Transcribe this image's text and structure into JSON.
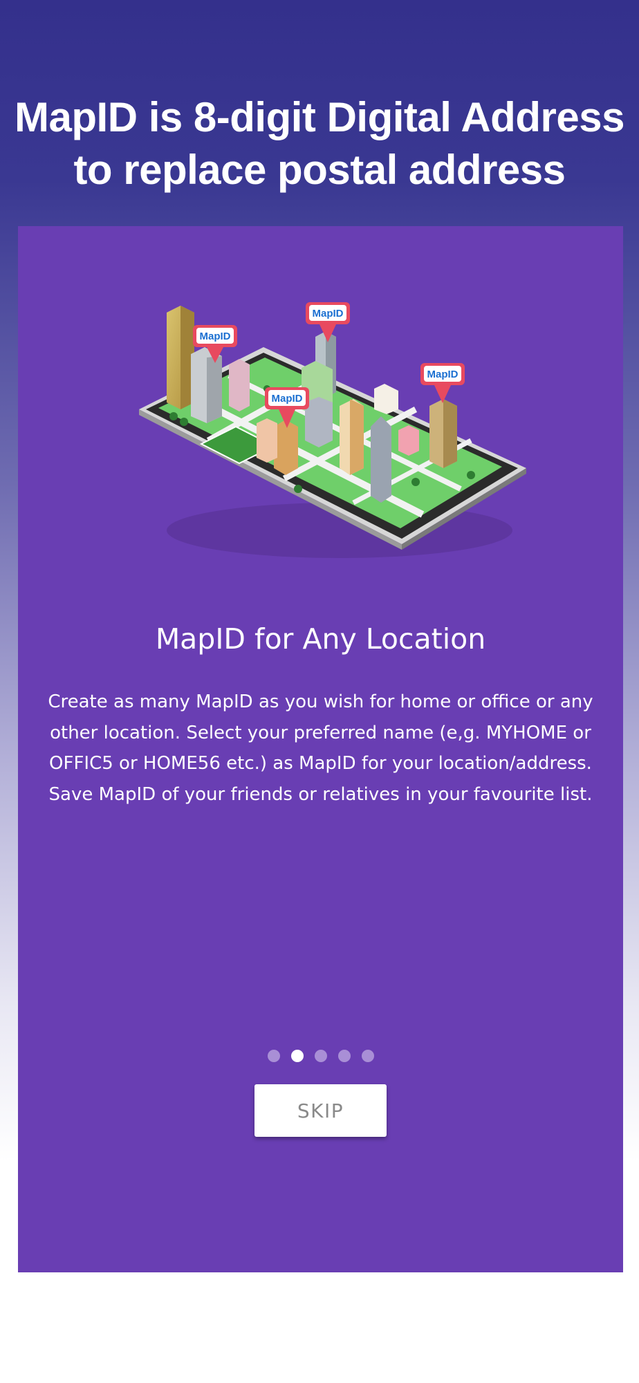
{
  "header": {
    "line1": "MapID is 8-digit Digital Address",
    "line2": "to replace postal address"
  },
  "slide": {
    "title": "MapID for Any Location",
    "description": "Create as many MapID as you wish for home or office or any other location. Select your preferred name (e,g. MYHOME or OFFIC5 or HOME56 etc.) as MapID for your location/address. Save MapID of your friends or relatives in your favourite list.",
    "pin_label": "MapID",
    "illustration_icon": "phone-city-map-icon"
  },
  "pagination": {
    "total": 5,
    "active_index": 1
  },
  "actions": {
    "skip_label": "SKIP"
  },
  "colors": {
    "background_top": "#34308c",
    "card": "#693eb3",
    "pin": "#e84a5f",
    "dot_inactive": "#a98fd6",
    "dot_active": "#ffffff"
  }
}
